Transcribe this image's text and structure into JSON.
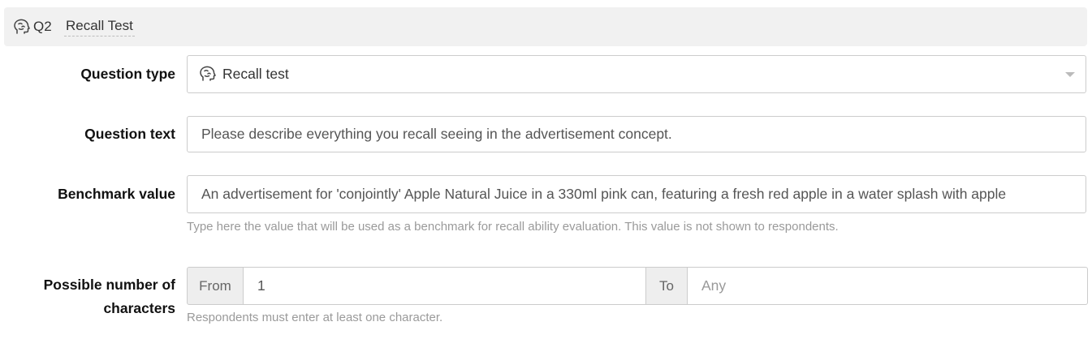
{
  "header": {
    "icon": "recall-head-icon",
    "number": "Q2",
    "title": "Recall Test"
  },
  "question_type": {
    "label": "Question type",
    "icon": "recall-head-icon",
    "value": "Recall test"
  },
  "question_text": {
    "label": "Question text",
    "value": "Please describe everything you recall seeing in the advertisement concept."
  },
  "benchmark": {
    "label": "Benchmark value",
    "value": "An advertisement for 'conjointly' Apple Natural Juice in a 330ml pink can, featuring a fresh red apple in a water splash with apple",
    "help": "Type here the value that will be used as a benchmark for recall ability evaluation. This value is not shown to respondents."
  },
  "characters": {
    "label_line1": "Possible number of",
    "label_line2": "characters",
    "from_label": "From",
    "from_value": "1",
    "to_label": "To",
    "to_placeholder": "Any",
    "help": "Respondents must enter at least one character."
  },
  "colors": {
    "header_bg": "#f1f1f1",
    "border": "#cccccc",
    "help_text": "#9a9a9a"
  }
}
